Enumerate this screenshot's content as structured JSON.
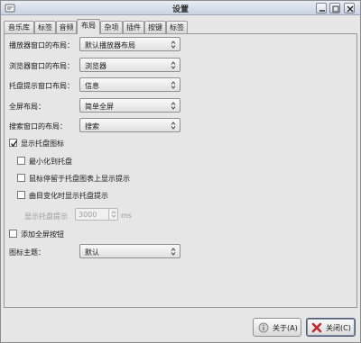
{
  "window": {
    "title": "设置"
  },
  "tabs": [
    {
      "label": "音乐库"
    },
    {
      "label": "标签"
    },
    {
      "label": "音频"
    },
    {
      "label": "布局"
    },
    {
      "label": "杂项"
    },
    {
      "label": "插件"
    },
    {
      "label": "按键"
    },
    {
      "label": "标签"
    }
  ],
  "layout": {
    "player_label": "播放器窗口的布局：",
    "player_value": "默认播放器布局",
    "browser_label": "浏览器窗口的布局：",
    "browser_value": "浏览器",
    "tray_tip_label": "托盘提示窗口布局：",
    "tray_tip_value": "信息",
    "fullscreen_label": "全屏布局：",
    "fullscreen_value": "简单全屏",
    "search_label": "搜索窗口的布局：",
    "search_value": "搜索"
  },
  "tray": {
    "show_tray_icon_label": "显示托盘图标",
    "show_tray_icon_checked": true,
    "minimize_to_tray_label": "最小化到托盘",
    "minimize_to_tray_checked": false,
    "hover_tip_label": "鼠标停留于托盘图表上显示提示",
    "hover_tip_checked": false,
    "song_change_tip_label": "曲目变化时显示托盘提示",
    "song_change_tip_checked": false,
    "tip_duration_label": "显示托盘提示",
    "tip_duration_value": "3000",
    "tip_duration_unit": "ms"
  },
  "fullscreen_button": {
    "label": "添加全屏按钮",
    "checked": false
  },
  "icon_theme": {
    "label": "图标主题：",
    "value": "默认"
  },
  "buttons": {
    "about": "关于(A)",
    "close": "关闭(C)"
  },
  "colors": {
    "accent": "#4a6fa5",
    "close_red": "#c0282d"
  }
}
